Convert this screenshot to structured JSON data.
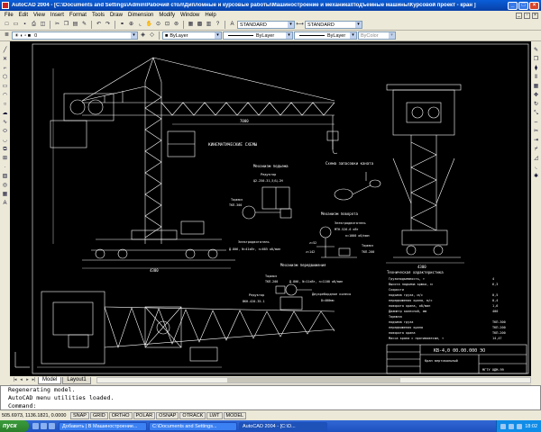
{
  "window": {
    "title": "AutoCAD 2004 - [C:\\Documents and Settings\\Admin\\Рабочий стол\\Дипломные и курсовые работы\\Машиностроение и механика\\Подъемные машины\\Курсовой проект - кран ]"
  },
  "menu": [
    "File",
    "Edit",
    "View",
    "Insert",
    "Format",
    "Tools",
    "Draw",
    "Dimension",
    "Modify",
    "Window",
    "Help"
  ],
  "toolbar": {
    "layer_combo": "0",
    "color_combo": "ByLayer",
    "linetype_combo": "ByLayer",
    "lineweight_combo": "ByLayer",
    "plotstyle_combo": "ByColor",
    "textstyle_combo": "STANDARD",
    "dimstyle_combo": "STANDARD"
  },
  "drawing": {
    "labels": {
      "kinematic": "КИНЕМАТИЧЕСКИЕ СХЕМЫ",
      "lifting_mech": "Механизм подъема",
      "reducer1": "Редуктор",
      "reducer1_model": "Ц2-250-31,5/Ц-2Н",
      "brake1": "Тормоз",
      "brake1_model": "ТКП-300",
      "motor1": "Электродвигатель",
      "motor1_spec": "Д-806, N=41кВт, n=685 об/мин",
      "rope_scheme": "Схема запасовки каната",
      "turn_mech": "Механизм поворота",
      "motor2": "Электродвигатель",
      "motor2_spec": "МТН-526-6 кВт",
      "motor2_n": "n=1000 об/мин",
      "brake2": "Тормоз",
      "brake2_model": "ТКП-200",
      "travel_mech": "Механизм передвижения",
      "brake3": "Тормоз",
      "brake3_model": "ТКП-200",
      "motor3_spec": "Д-806, N=11кВт, n=1100 об/мин",
      "reducer3": "Редуктор",
      "reducer3_model": "ВКН-420-35-1",
      "wheel": "Двухребордное колесо",
      "wheel_d": "D=400мм",
      "z1": "z=52",
      "z2": "z=142",
      "tech_title": "Техническая характеристика",
      "dim_a": "4300",
      "dim_b": "4300",
      "dim_c": "7000",
      "title_doc": "КВ-4,0 00.00.000 ЭО",
      "title_name": "Кран вертикальный",
      "title_org": "МГТУ ОДМ-99"
    },
    "specs": [
      {
        "label": "Грузоподъемность, т",
        "value": "4"
      },
      {
        "label": "Высота подъема крюка, м",
        "value": "6,3"
      },
      {
        "label": "Скорости",
        "value": ""
      },
      {
        "label": "подъема груза, м/с",
        "value": "0,5"
      },
      {
        "label": "передвижения крана, м/с",
        "value": "0,4"
      },
      {
        "label": "поворота крана, об/мин",
        "value": "1,6"
      },
      {
        "label": "Диаметр колесной, мм",
        "value": "400"
      },
      {
        "label": "Тормоза",
        "value": ""
      },
      {
        "label": "подъема груза",
        "value": "ТКП-300"
      },
      {
        "label": "передвижения крана",
        "value": "ТКП-200"
      },
      {
        "label": "поворота крана",
        "value": "ТКП-200"
      },
      {
        "label": "Масса крана с противовесом, т",
        "value": "14,47"
      }
    ]
  },
  "tabs": [
    "Model",
    "Layout1"
  ],
  "command": {
    "lines": [
      "Regenerating model.",
      "AutoCAD menu utilities loaded.",
      "Command:"
    ]
  },
  "status": {
    "coords": "505.6973, 1136.1821, 0.0000",
    "buttons": [
      "SNAP",
      "GRID",
      "ORTHO",
      "POLAR",
      "OSNAP",
      "OTRACK",
      "LWT",
      "MODEL"
    ]
  },
  "taskbar": {
    "start": "пуск",
    "tasks": [
      "Добавить | В Машиностроение...",
      "C:\\Documents and Settings...",
      "AutoCAD 2004 - [C:\\D..."
    ],
    "clock": "18:02"
  },
  "colors": {
    "canvas": "#000000",
    "line": "#ffffff",
    "accent": "#0a5ed8"
  }
}
